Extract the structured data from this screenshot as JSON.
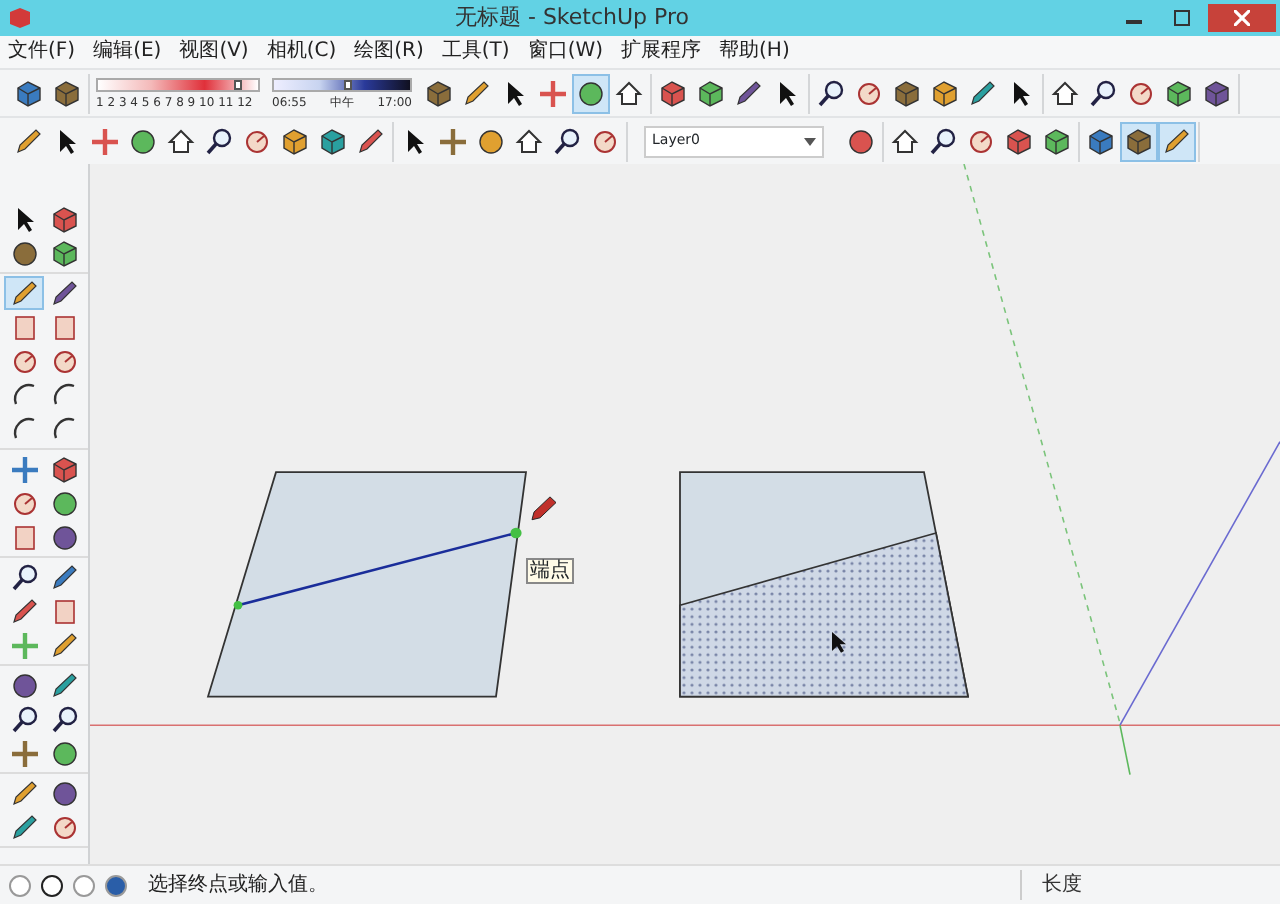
{
  "window": {
    "title": "无标题 - SketchUp Pro"
  },
  "menu": [
    "文件(F)",
    "编辑(E)",
    "视图(V)",
    "相机(C)",
    "绘图(R)",
    "工具(T)",
    "窗口(W)",
    "扩展程序",
    "帮助(H)"
  ],
  "toolbar_1": {
    "left_groups": [
      [
        {
          "selected": false
        },
        {
          "selected": false
        }
      ]
    ],
    "shadow_settings": {
      "months": "1 2 3 4 5 6 7 8 9 10 11 12",
      "month_slider": {
        "level": 0.88
      },
      "time_start": "06:55",
      "time_noon": "中午",
      "time_end": "17:00",
      "time_slider": {
        "level": 0.55
      }
    },
    "right_groups": [
      [
        {
          "selected": false
        },
        {
          "selected": false
        },
        {
          "selected": false
        },
        {
          "selected": false
        },
        {
          "selected": true
        },
        {
          "selected": false
        }
      ],
      [
        {
          "selected": false
        },
        {
          "selected": false
        },
        {
          "selected": false
        },
        {
          "selected": false
        }
      ],
      [
        {
          "selected": false
        },
        {
          "selected": false
        },
        {
          "selected": false
        },
        {
          "selected": false
        },
        {
          "selected": false
        },
        {
          "selected": false
        }
      ],
      [
        {
          "selected": false
        },
        {
          "selected": false
        },
        {
          "selected": false
        },
        {
          "selected": false
        },
        {
          "selected": false
        }
      ]
    ]
  },
  "toolbar_2": {
    "left_groups": [
      [
        {
          "selected": false
        },
        {
          "selected": false
        },
        {
          "selected": false
        },
        {
          "selected": false
        },
        {
          "selected": false
        },
        {
          "selected": false
        },
        {
          "selected": false
        },
        {
          "selected": false
        },
        {
          "selected": false
        },
        {
          "selected": false
        }
      ],
      [
        {
          "selected": false
        },
        {
          "selected": false
        },
        {
          "selected": false
        },
        {
          "selected": false
        },
        {
          "selected": false
        },
        {
          "selected": false
        }
      ]
    ],
    "layer_selector": {
      "value": "Layer0"
    },
    "right_groups": [
      [
        {
          "selected": false
        }
      ],
      [
        {
          "selected": false
        },
        {
          "selected": false
        },
        {
          "selected": false
        },
        {
          "selected": false
        },
        {
          "selected": false
        }
      ],
      [
        {
          "selected": false
        },
        {
          "selected": true
        },
        {
          "selected": true
        }
      ]
    ]
  },
  "left_toolbar": [
    [
      {
        "selected": false
      },
      {
        "selected": false
      },
      {
        "selected": false
      },
      {
        "selected": false
      }
    ],
    [
      {
        "selected": true
      },
      {
        "selected": false
      },
      {
        "selected": false
      },
      {
        "selected": false
      },
      {
        "selected": false
      },
      {
        "selected": false
      },
      {
        "selected": false
      },
      {
        "selected": false
      },
      {
        "selected": false
      },
      {
        "selected": false
      }
    ],
    [
      {
        "selected": false
      },
      {
        "selected": false
      },
      {
        "selected": false
      },
      {
        "selected": false
      },
      {
        "selected": false
      },
      {
        "selected": false
      }
    ],
    [
      {
        "selected": false
      },
      {
        "selected": false
      },
      {
        "selected": false
      },
      {
        "selected": false
      },
      {
        "selected": false
      },
      {
        "selected": false
      }
    ],
    [
      {
        "selected": false
      },
      {
        "selected": false
      },
      {
        "selected": false
      },
      {
        "selected": false
      },
      {
        "selected": false
      },
      {
        "selected": false
      }
    ],
    [
      {
        "selected": false
      },
      {
        "selected": false
      },
      {
        "selected": false
      },
      {
        "selected": false
      }
    ]
  ],
  "canvas": {
    "tooltip": "端点"
  },
  "status_bar": {
    "message": "选择终点或输入值。",
    "measurement_label": "长度"
  }
}
